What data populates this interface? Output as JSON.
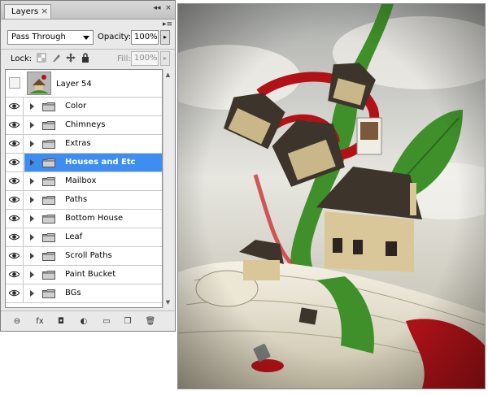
{
  "panel": {
    "tab_label": "Layers",
    "tab_close": "×",
    "win_minimize": "◂◂",
    "win_close": "×",
    "menu_icon": "▸≡",
    "blend_mode": "Pass Through",
    "opacity_label": "Opacity:",
    "opacity_value": "100%",
    "lock_label": "Lock:",
    "fill_label": "Fill:",
    "fill_value": "100%",
    "arrow_glyph": "▸"
  },
  "top_layer": {
    "name": "Layer 54",
    "visible": false
  },
  "groups": [
    {
      "name": "Color",
      "visible": true,
      "selected": false
    },
    {
      "name": "Chimneys",
      "visible": true,
      "selected": false
    },
    {
      "name": "Extras",
      "visible": true,
      "selected": false
    },
    {
      "name": "Houses and Etc",
      "visible": true,
      "selected": true
    },
    {
      "name": "Mailbox",
      "visible": true,
      "selected": false
    },
    {
      "name": "Paths",
      "visible": true,
      "selected": false
    },
    {
      "name": "Bottom House",
      "visible": true,
      "selected": false
    },
    {
      "name": "Leaf",
      "visible": true,
      "selected": false
    },
    {
      "name": "Scroll Paths",
      "visible": true,
      "selected": false
    },
    {
      "name": "Paint Bucket",
      "visible": true,
      "selected": false
    },
    {
      "name": "BGs",
      "visible": true,
      "selected": false
    }
  ],
  "bottom_icons": [
    "link-icon",
    "fx-icon",
    "mask-icon",
    "adjustment-icon",
    "new-group-icon",
    "new-layer-icon",
    "trash-icon"
  ],
  "bottom_glyphs": [
    "⊖",
    "fx",
    "◘",
    "◐",
    "▭",
    "❐",
    "🗑"
  ],
  "colors": {
    "selection": "#3d8ef0",
    "panel_bg": "#e9e9e9",
    "art_green": "#3f8f2a",
    "art_red": "#b01218",
    "art_sky": "#cfcfcf"
  }
}
